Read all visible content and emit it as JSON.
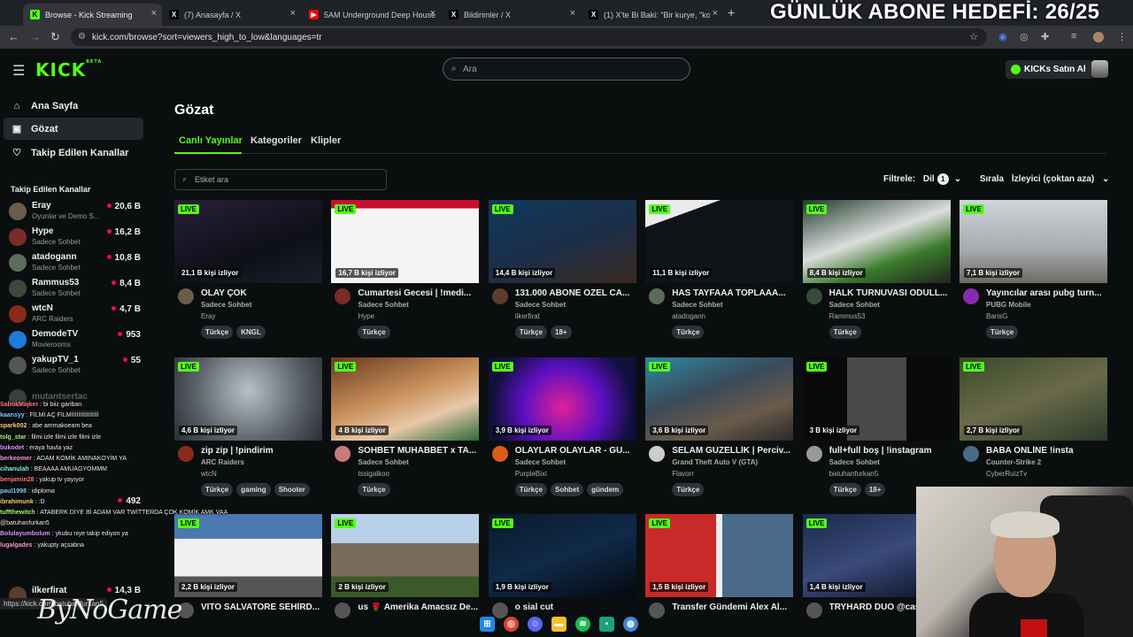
{
  "overlay_title": "GÜNLÜK ABONE HEDEFİ: 26/25",
  "browser": {
    "tabs": [
      {
        "label": "Browse - Kick Streaming",
        "icon": "kick-icon",
        "active": true
      },
      {
        "label": "(7) Anasayfa / X",
        "icon": "x-icon"
      },
      {
        "label": "5AM Underground Deep House",
        "icon": "youtube-icon"
      },
      {
        "label": "Bildirimler / X",
        "icon": "x-icon"
      },
      {
        "label": "(1) X'te Bi Baki: \"Bir kurye, \"kola",
        "icon": "x-icon"
      }
    ],
    "url": "kick.com/browse?sort=viewers_high_to_low&languages=tr"
  },
  "header": {
    "logo": "KICK",
    "logo_badge": "BETA",
    "search_placeholder": "Ara",
    "buy_kicks": "KICKs Satın Al"
  },
  "sidebar": {
    "nav": [
      {
        "label": "Ana Sayfa",
        "icon": "home-icon"
      },
      {
        "label": "Gözat",
        "icon": "browse-icon",
        "selected": true
      },
      {
        "label": "Takip Edilen Kanallar",
        "icon": "heart-icon"
      }
    ],
    "followed_heading": "Takip Edilen Kanallar",
    "channels": [
      {
        "name": "Eray",
        "category": "Oyunlar ve Demo S...",
        "viewers": "20,6 B",
        "color": "#6b5b4a"
      },
      {
        "name": "Hype",
        "category": "Sadece Sohbet",
        "viewers": "16,2 B",
        "color": "#7a2b2b"
      },
      {
        "name": "atadogann",
        "category": "Sadece Sohbet",
        "viewers": "10,8 B",
        "color": "#5d6b5a"
      },
      {
        "name": "Rammus53",
        "category": "Sadece Sohbet",
        "viewers": "8,4 B",
        "color": "#3a4a3a"
      },
      {
        "name": "wtcN",
        "category": "ARC Raiders",
        "viewers": "4,7 B",
        "color": "#8a2a1a"
      },
      {
        "name": "DemodeTV",
        "category": "Movierooms",
        "viewers": "953",
        "color": "#1e7bd8"
      },
      {
        "name": "yakupTV_1",
        "category": "Sadece Sohbet",
        "viewers": "55",
        "color": "#555"
      }
    ],
    "offline_channel": "mutantsertac",
    "bottom_channel": {
      "name": "ilkerfirat",
      "viewers": "14,3 B"
    },
    "side_count": "492"
  },
  "main": {
    "title": "Gözat",
    "tabs": [
      "Canlı Yayınlar",
      "Kategoriler",
      "Klipler"
    ],
    "tag_search_placeholder": "Etiket ara",
    "filter_label": "Filtrele:",
    "language_label": "Dil",
    "language_count": "1",
    "sort_label": "Sırala",
    "sort_value": "İzleyici (çoktan aza)",
    "live_label": "LIVE",
    "streams": [
      {
        "viewers": "21,1 B kişi izliyor",
        "title": "OLAY ÇOK",
        "category": "Sadece Sohbet",
        "streamer": "Eray",
        "tags": [
          "Türkçe",
          "KNGL"
        ],
        "thumb": "linear-gradient(160deg,#2a1f3a,#0e1018 60%,#1b1d2a)",
        "av": "#6b5b4a"
      },
      {
        "viewers": "16,7 B kişi izliyor",
        "title": "Cumartesi Gecesi | !medi...",
        "category": "Sadece Sohbet",
        "streamer": "Hype",
        "tags": [
          "Türkçe"
        ],
        "thumb": "linear-gradient(180deg,#c8102e 0 10%,#f4f4f4 10% 100%)",
        "av": "#7a2b2b"
      },
      {
        "viewers": "14,4 B kişi izliyor",
        "title": "131.000 ABONE ÖZEL CA...",
        "category": "Sadece Sohbet",
        "streamer": "ilkerfirat",
        "tags": [
          "Türkçe",
          "18+"
        ],
        "thumb": "linear-gradient(160deg,#0f3a5a,#1a2e4a 50%,#3a2a20)",
        "av": "#5a3d2e"
      },
      {
        "viewers": "11,1 B kişi izliyor",
        "title": "HAS TAYFAAA TOPLAAA...",
        "category": "Sadece Sohbet",
        "streamer": "atadogann",
        "tags": [
          "Türkçe"
        ],
        "thumb": "linear-gradient(160deg,#eaeaea 0 20%,#101418 20% 100%)",
        "av": "#5d6b5a"
      },
      {
        "viewers": "8,4 B kişi izliyor",
        "title": "HALK TURNUVASI ÖDÜLL...",
        "category": "Sadece Sohbet",
        "streamer": "Rammus53",
        "tags": [
          "Türkçe"
        ],
        "thumb": "linear-gradient(160deg,#1d3b2a,#ddd 45%,#3a7a2a 70%,#222)",
        "av": "#3a4a3a"
      },
      {
        "viewers": "7,1 B kişi izliyor",
        "title": "Yayıncılar arası pubg turn...",
        "category": "PUBG Mobile",
        "streamer": "BarisG",
        "tags": [
          "Türkçe"
        ],
        "thumb": "linear-gradient(180deg,#cfd4d8,#a7abaf 60%,#6c6a62)",
        "av": "#8a2ab0"
      },
      {
        "viewers": "4,6 B kişi izliyor",
        "title": "zip zip | !pindirim",
        "category": "ARC Raiders",
        "streamer": "wtcN",
        "tags": [
          "Türkçe",
          "gaming",
          "Shooter"
        ],
        "thumb": "radial-gradient(circle at 50% 40%,#b8c0c8,#5a6068 60%,#2a2e34)",
        "av": "#8a2a1a"
      },
      {
        "viewers": "4 B kişi izliyor",
        "title": "SOHBET MUHABBET x TA...",
        "category": "Sadece Sohbet",
        "streamer": "tssigalkoo",
        "tags": [
          "Türkçe"
        ],
        "thumb": "linear-gradient(160deg,#6a3a20,#c8905a 45%,#e8c8a8 70%,#2a6a3a)",
        "av": "#c77a7a"
      },
      {
        "viewers": "3,9 B kişi izliyor",
        "title": "OLAYLAR OLAYLAR - GÜ...",
        "category": "Sadece Sohbet",
        "streamer": "PurpleBixi",
        "tags": [
          "Türkçe",
          "Sohbet",
          "gündem"
        ],
        "thumb": "radial-gradient(circle at 50% 60%,#e0209a,#5a10c0 45%,#10103a 80%)",
        "av": "#e05a1a"
      },
      {
        "viewers": "3,6 B kişi izliyor",
        "title": "SELAM GÜZELLİK | Perciv...",
        "category": "Grand Theft Auto V (GTA)",
        "streamer": "Flavorr",
        "tags": [
          "Türkçe"
        ],
        "thumb": "linear-gradient(160deg,#2a8aa0,#3a4a5a 40%,#6a5a4a 70%,#2a2a2a)",
        "av": "#ccc"
      },
      {
        "viewers": "3 B kişi izliyor",
        "title": "full+full boş | !instagram",
        "category": "Sadece Sohbet",
        "streamer": "batuhanfurkan5",
        "tags": [
          "Türkçe",
          "18+"
        ],
        "thumb": "linear-gradient(90deg,#0a0a0a 0 30%,#4a4a4a 30% 70%,#0a0a0a 70%)",
        "av": "#999"
      },
      {
        "viewers": "2,7 B kişi izliyor",
        "title": "BABA ONLİNE !insta",
        "category": "Counter-Strike 2",
        "streamer": "CyberRuizTv",
        "tags": [],
        "thumb": "linear-gradient(160deg,#3a4a2a,#6a6a4a 50%,#2a3a2a)",
        "av": "#4a6a8a"
      },
      {
        "viewers": "2,2 B kişi izliyor",
        "title": "VITO SALVATORE SEHİRD...",
        "category": "",
        "streamer": "",
        "tags": [],
        "thumb": "linear-gradient(180deg,#4a7ab0 0 30%,#f0f0f0 30% 75%,#555 75%)",
        "av": "#555"
      },
      {
        "viewers": "2 B kişi izliyor",
        "title": "us 🌹 Amerika Amacsız De...",
        "category": "",
        "streamer": "",
        "tags": [],
        "thumb": "linear-gradient(180deg,#b8d0e8 0 35%,#7a6a5a 35% 75%,#3a5a2a 75%)",
        "av": "#555"
      },
      {
        "viewers": "1,9 B kişi izliyor",
        "title": "o sial cut",
        "category": "",
        "streamer": "",
        "tags": [],
        "thumb": "linear-gradient(160deg,#0a1a2a,#102a4a 50%,#05080e)",
        "av": "#555"
      },
      {
        "viewers": "1,5 B kişi izliyor",
        "title": "Transfer Gündemi Alex Al...",
        "category": "",
        "streamer": "",
        "tags": [],
        "thumb": "linear-gradient(90deg,#c82a2a 0 48%,#eee 48% 52%,#4a6a8a 52%)",
        "av": "#555"
      },
      {
        "viewers": "1,4 B kişi izliyor",
        "title": "TRYHARD DUO @casc",
        "category": "",
        "streamer": "",
        "tags": [],
        "thumb": "linear-gradient(160deg,#1a2a4a,#3a4a7a 50%,#0a1020)",
        "av": "#555"
      }
    ]
  },
  "chat": [
    {
      "user": "SabokMajker",
      "msg": ": bi biiz gariban"
    },
    {
      "user": "kaansyy",
      "msg": ": FİLMİ AÇ FİLMİİİİİİİİİİİİİİİİ"
    },
    {
      "user": "spark002",
      "msg": ": abe ammakoeam bea"
    },
    {
      "user": "tolg_star",
      "msg": ": filmi izle filmi izle filmi izle"
    },
    {
      "user": "bukodet",
      "msg": ": eraya havla yaz"
    },
    {
      "user": "berkeomer",
      "msg": ": ADAM KOMİK AMINAKOYİM YA"
    },
    {
      "user": "cihanulah",
      "msg": ": BEAAAA AMUAGYOMMM"
    },
    {
      "user": "benjamin28",
      "msg": ": yakup tv yayıyor"
    },
    {
      "user": "paul1998",
      "msg": ": idiploma"
    },
    {
      "user": "ibrahimunk",
      "msg": ": :D"
    },
    {
      "user": "tuffthewitch",
      "msg": ": ATABERK DİYE Bİ ADAM VAR TWİTTERDA ÇOK KOMİK AMK VAA @batuhanfurkan5"
    },
    {
      "user": "Bolulayumbolum",
      "msg": ": ykubu niye takip ediyon ya"
    },
    {
      "user": "lugalgades",
      "msg": ": yakupty açsabna"
    }
  ],
  "status_url": "https://kick.com/batuhanfurkan5",
  "watermark": "ByNoGame"
}
